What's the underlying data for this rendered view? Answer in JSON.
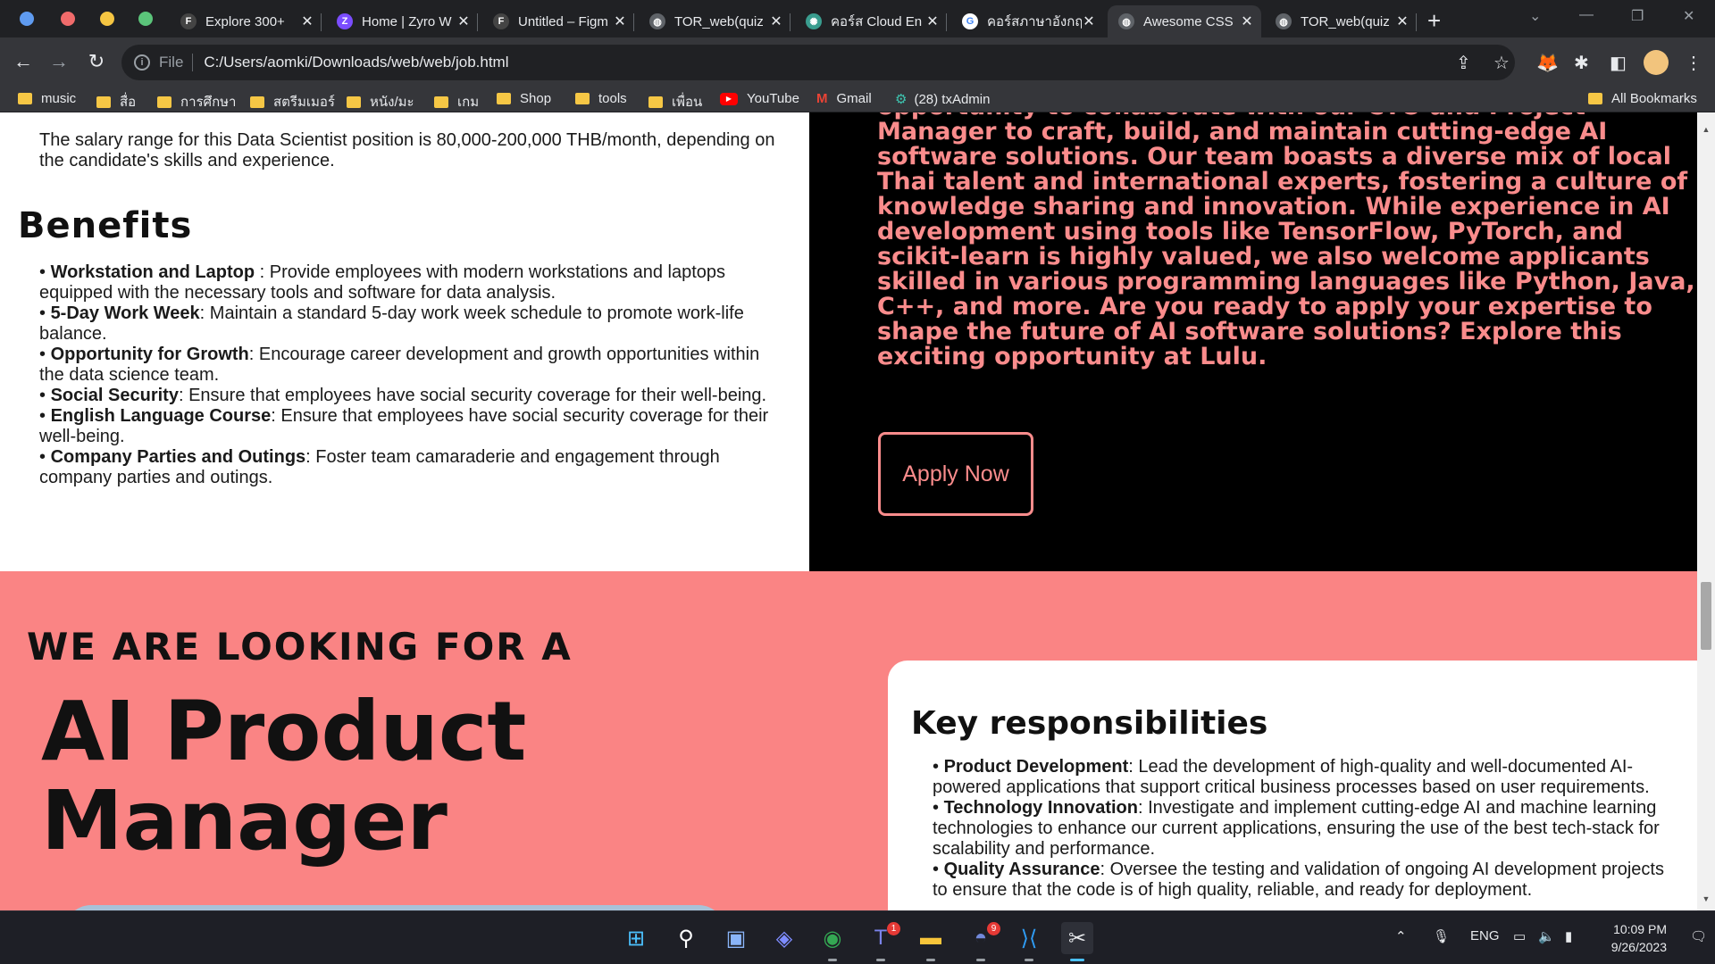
{
  "browser": {
    "tabs": [
      {
        "title": "Explore 300+",
        "active": false
      },
      {
        "title": "Home | Zyro W",
        "active": false
      },
      {
        "title": "Untitled – Figm",
        "active": false
      },
      {
        "title": "TOR_web(quiz",
        "active": false
      },
      {
        "title": "คอร์ส Cloud En",
        "active": false
      },
      {
        "title": "คอร์สภาษาอังกฤ",
        "active": false
      },
      {
        "title": "Awesome CSS",
        "active": true
      },
      {
        "title": "TOR_web(quiz",
        "active": false
      }
    ],
    "new_tab": "+",
    "address": {
      "scheme_label": "File",
      "url": "C:/Users/aomki/Downloads/web/web/job.html"
    },
    "bookmarks": [
      "music",
      "สื่อ",
      "การศึกษา",
      "สตรีมเมอร์",
      "หนัง/มะ",
      "เกม",
      "Shop",
      "tools",
      "เพื่อน",
      "YouTube",
      "Gmail",
      "(28) txAdmin"
    ],
    "all_bookmarks": "All Bookmarks"
  },
  "page": {
    "salary_text": "The salary range for this Data Scientist position is 80,000-200,000 THB/month, depending on the candidate's skills and experience.",
    "benefits_title": "Benefits",
    "benefits": [
      {
        "bold": "Workstation and Laptop",
        "text": " : Provide employees with modern workstations and laptops equipped with the necessary tools and software for data analysis."
      },
      {
        "bold": "5-Day Work Week",
        "text": ": Maintain a standard 5-day work week schedule to promote work-life balance."
      },
      {
        "bold": "Opportunity for Growth",
        "text": ": Encourage career development and growth opportunities within the data science team."
      },
      {
        "bold": "Social Security",
        "text": ": Ensure that employees have social security coverage for their well-being."
      },
      {
        "bold": "English Language Course",
        "text": ": Ensure that employees have social security coverage for their well-being."
      },
      {
        "bold": "Company Parties and Outings",
        "text": ": Foster team camaraderie and engagement through company parties and outings."
      }
    ],
    "intro_text": "opportunity to collaborate with our CTO and Project Manager to craft, build, and maintain cutting-edge AI software solutions. Our team boasts a diverse mix of local Thai talent and international experts, fostering a culture of knowledge sharing and innovation. While experience in AI development using tools like TensorFlow, PyTorch, and scikit-learn is highly valued, we also welcome applicants skilled in various programming languages like Python, Java, C++, and more. Are you ready to apply your expertise to shape the future of AI software solutions? Explore this exciting opportunity at Lulu.",
    "apply_label": "Apply Now",
    "looking_for": "WE ARE LOOKING FOR A",
    "role_title": "AI Product Manager",
    "responsibilities_title": "Key responsibilities",
    "responsibilities": [
      {
        "bold": "Product Development",
        "text": ": Lead the development of high-quality and well-documented AI-powered applications that support critical business processes based on user requirements."
      },
      {
        "bold": "Technology Innovation",
        "text": ": Investigate and implement cutting-edge AI and machine learning technologies to enhance our current applications, ensuring the use of the best tech-stack for scalability and performance."
      },
      {
        "bold": "Quality Assurance",
        "text": ": Oversee the testing and validation of ongoing AI development projects to ensure that the code is of high quality, reliable, and ready for deployment."
      }
    ]
  },
  "taskbar": {
    "teams_badge": "1",
    "discord_badge": "9",
    "language": "ENG",
    "time": "10:09 PM",
    "date": "9/26/2023"
  },
  "colors": {
    "accent_pink": "#fa8c8c",
    "section_pink": "#fa8484"
  }
}
